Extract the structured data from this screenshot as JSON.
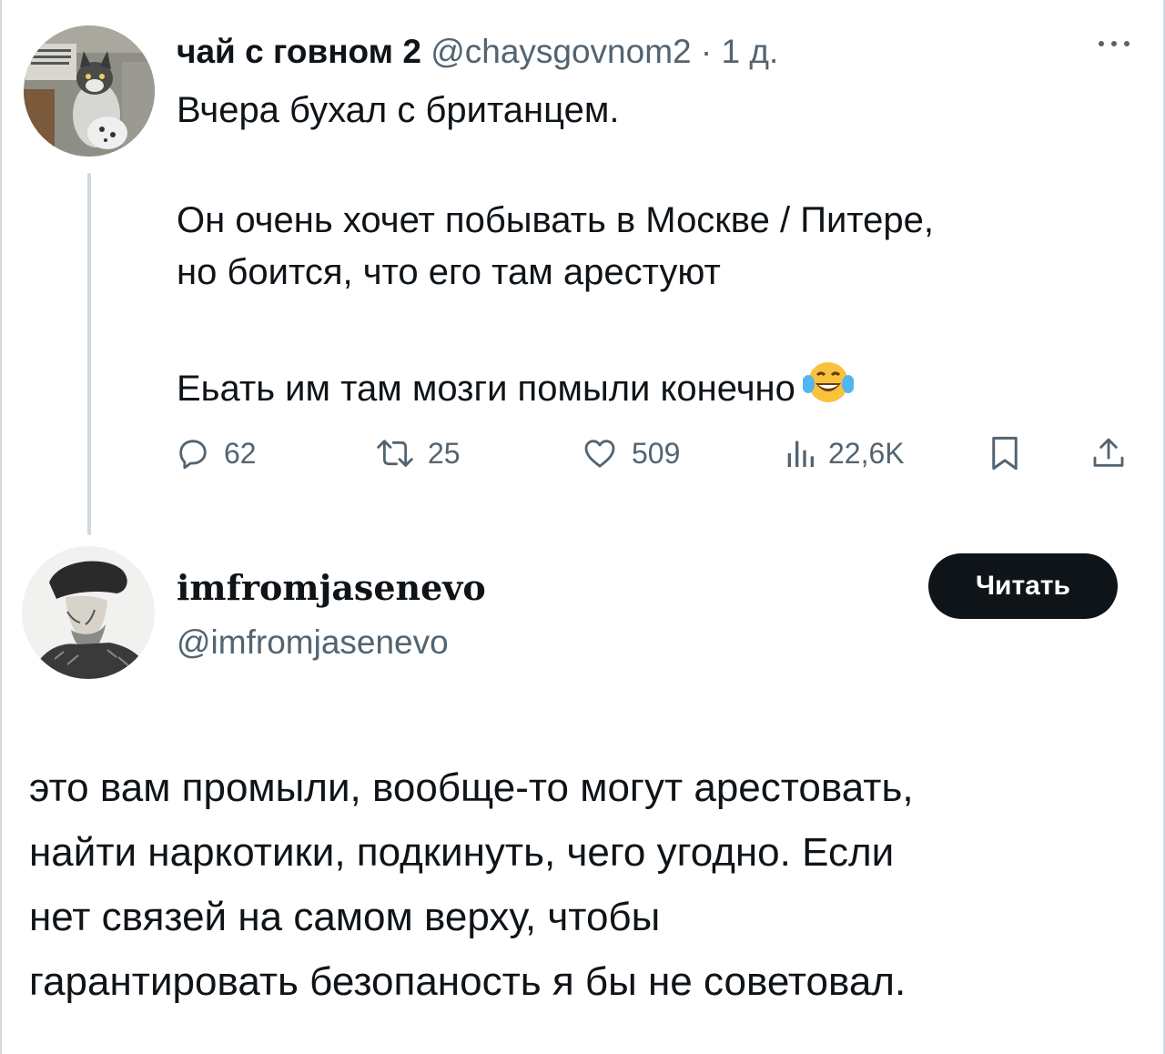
{
  "tweet": {
    "author_name": "чай с говном 2",
    "author_handle": "@chaysgovnom2",
    "separator": "·",
    "time": "1 д.",
    "more_icon": "more-dots-icon",
    "lines": [
      "Вчера бухал с британцем.",
      "Он очень хочет побывать в Москве / Питере,",
      "но боится, что его там арестуют",
      "Еьать им там мозги помыли конечно"
    ],
    "emoji": "laughing-tears-emoji",
    "stats": {
      "replies": "62",
      "retweets": "25",
      "likes": "509",
      "views": "22,6K"
    }
  },
  "reply_card": {
    "name": "imfromjasenevo",
    "handle": "@imfromjasenevo",
    "follow_label": "Читать",
    "text_lines": [
      "это вам промыли, вообще-то могут арестовать,",
      "найти наркотики, подкинуть, чего угодно. Если",
      "нет связей на самом верху, чтобы",
      "гарантировать безопаность я бы не советовал."
    ]
  },
  "colors": {
    "text": "#0f1419",
    "secondary": "#536471",
    "border": "#cfd9de",
    "button_bg": "#0f1419",
    "emoji_yellow": "#f9c23c",
    "emoji_tears": "#4fb6f0"
  }
}
